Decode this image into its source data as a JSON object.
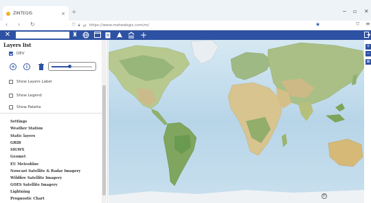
{
  "browser": {
    "tab_title": "ZINTEGIS",
    "tab_close": "×",
    "new_tab": "+",
    "url": "https://www.metwebgis.com/m/",
    "win_min": "−",
    "win_max": "▫",
    "win_close": "✕"
  },
  "toolbar": {
    "close_icon": "✕",
    "search_placeholder": "",
    "icons": [
      "notification-icon",
      "globe-icon",
      "layer-window-icon",
      "clipboard-icon",
      "rocket-icon",
      "sliders-icon",
      "plus-icon"
    ],
    "right_icon": "exit-icon"
  },
  "sidebar": {
    "title": "Layers list",
    "layer": {
      "label": "DEV",
      "checked": true
    },
    "opacity": 0.45,
    "options": [
      {
        "label": "Show Layers Label",
        "checked": false
      },
      {
        "label": "Show Legend",
        "checked": false
      },
      {
        "label": "Show Palette",
        "checked": false
      }
    ],
    "menu": [
      "Settings",
      "Weather Station",
      "Static layers",
      "GRIB",
      "SIGWX",
      "Geomet",
      "EU Meteoblue",
      "Nowcast Satellite & Radar Imagery",
      "Wildfire Satellite Imagery",
      "GOES Satellite Imagery",
      "Lightning",
      "Prognostic Chart"
    ]
  },
  "map": {
    "attribution_icon": "©",
    "side_buttons": [
      "+",
      "−",
      "⊞"
    ]
  }
}
